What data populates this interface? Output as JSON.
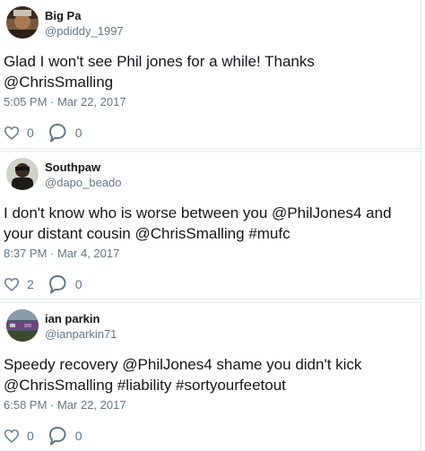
{
  "tweets": [
    {
      "name": "Big Pa",
      "handle": "@pdiddy_1997",
      "text_lines": [
        "Glad I won't see Phil jones for a while! Thanks",
        "@ChrisSmalling"
      ],
      "time": "5:05 PM · Mar 22, 2017",
      "likes": "0",
      "replies": "0"
    },
    {
      "name": "Southpaw",
      "handle": "@dapo_beado",
      "text_lines": [
        "I don't know who is worse between you @PhilJones4 and",
        "your distant cousin @ChrisSmalling #mufc"
      ],
      "time": "8:37 PM · Mar 4, 2017",
      "likes": "2",
      "replies": "0"
    },
    {
      "name": "ian parkin",
      "handle": "@ianparkin71",
      "text_lines": [
        "Speedy recovery @PhilJones4 shame you didn't kick",
        "@ChrisSmalling #liability #sortyourfeetout"
      ],
      "time": "6:58 PM · Mar 22, 2017",
      "likes": "0",
      "replies": "0"
    }
  ],
  "icons": {
    "like": "heart-icon",
    "reply": "speech-bubble-icon"
  },
  "colors": {
    "muted": "#657786",
    "text": "#14171a",
    "divider": "#e1e8ed"
  }
}
